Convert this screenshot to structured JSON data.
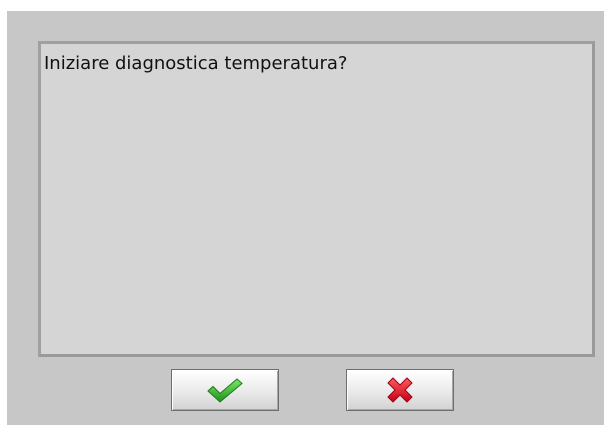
{
  "dialog": {
    "message": "Iniziare diagnostica temperatura?"
  },
  "buttons": {
    "confirm": {
      "icon": "checkmark-icon",
      "color": "#2fb02a"
    },
    "cancel": {
      "icon": "x-icon",
      "color": "#e0102a"
    }
  }
}
